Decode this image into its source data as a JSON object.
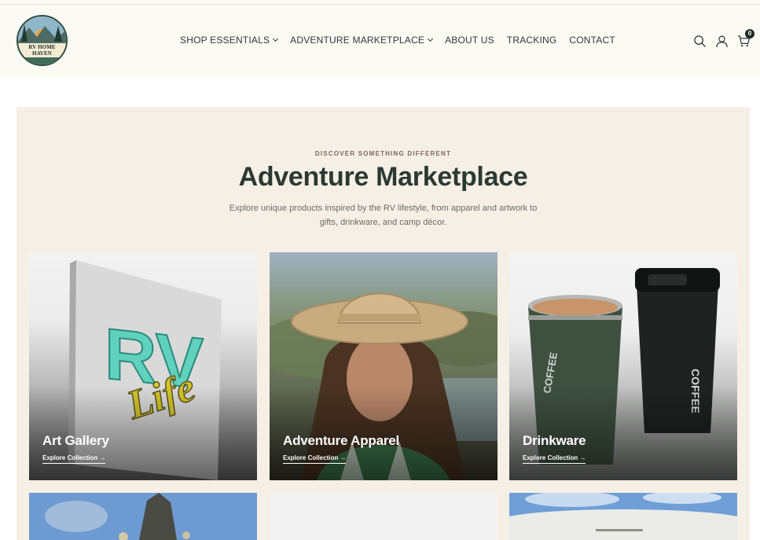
{
  "brand": {
    "logo_text": "RV HOME HAVEN"
  },
  "nav": {
    "items": [
      {
        "label": "SHOP ESSENTIALS",
        "dropdown": true
      },
      {
        "label": "ADVENTURE MARKETPLACE",
        "dropdown": true
      },
      {
        "label": "ABOUT US",
        "dropdown": false
      },
      {
        "label": "TRACKING",
        "dropdown": false
      },
      {
        "label": "CONTACT",
        "dropdown": false
      }
    ]
  },
  "header_icons": [
    "search-icon",
    "account-icon",
    "cart-icon"
  ],
  "cart": {
    "count": "0"
  },
  "hero": {
    "eyebrow": "DISCOVER SOMETHING DIFFERENT",
    "title": "Adventure Marketplace",
    "subtitle": "Explore unique products inspired by the RV lifestyle, from apparel and artwork to gifts, drinkware, and camp décor."
  },
  "cards": [
    {
      "title": "Art Gallery",
      "link": "Explore Collection →",
      "image_text_1": "RV",
      "image_text_2": "Life"
    },
    {
      "title": "Adventure Apparel",
      "link": "Explore Collection →"
    },
    {
      "title": "Drinkware",
      "link": "Explore Collection →",
      "image_text": "COFFEE"
    }
  ],
  "colors": {
    "header_bg": "#fbfbf3",
    "section_bg": "#f6efe6",
    "title": "#2a3a33",
    "eyebrow": "#7a6a56"
  }
}
